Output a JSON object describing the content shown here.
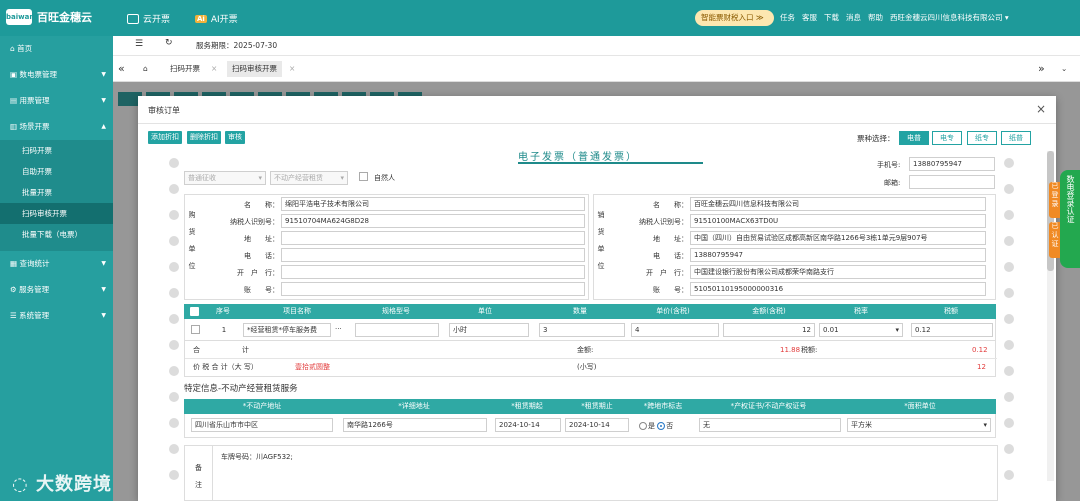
{
  "app": {
    "brand_badge": "baiwang",
    "name": "百旺金穗云"
  },
  "topnav": [
    {
      "label": "云开票"
    },
    {
      "label": "AI开票",
      "badge": "Ai"
    }
  ],
  "entry_button": "智能票财税入口 ≫",
  "toplinks": [
    "任务",
    "客服",
    "下载",
    "消息",
    "帮助",
    "西旺金穗云四川信息科技有限公司 ▾"
  ],
  "sidebar": {
    "items": [
      {
        "label": "首页"
      },
      {
        "label": "数电票管理"
      },
      {
        "label": "用票管理"
      },
      {
        "label": "场景开票"
      }
    ],
    "sub_items": [
      {
        "label": "扫码开票"
      },
      {
        "label": "自助开票"
      },
      {
        "label": "批量开票"
      },
      {
        "label": "扫码审核开票"
      },
      {
        "label": "批量下载（电票）"
      }
    ],
    "items_after": [
      {
        "label": "查询统计"
      },
      {
        "label": "服务管理"
      },
      {
        "label": "系统管理"
      }
    ]
  },
  "toolbar": {
    "service_period": "服务期限：2025-07-30"
  },
  "tabs": [
    "扫码开票",
    "扫码审核开票"
  ],
  "modal": {
    "title": "审核订单",
    "actions": [
      "添加折扣",
      "删除折扣",
      "审核"
    ],
    "ptype_label": "票种选择：",
    "ptypes": [
      "电普",
      "电专",
      "纸专",
      "纸普"
    ],
    "invoice_title": "电子发票（普通发票）",
    "phone_label": "手机号:",
    "phone_value": "13880795947",
    "email_label": "邮箱:",
    "email_value": "",
    "select1": "普通征收",
    "select2": "不动产经营租赁",
    "natural_person": "自然人",
    "buyer": {
      "side": [
        "购",
        "货",
        "单",
        "位"
      ],
      "rows": [
        {
          "label": "名　　称：",
          "value": "绵阳平浩电子技术有限公司"
        },
        {
          "label": "纳税人识别号：",
          "value": "91510704MA624G8D28"
        },
        {
          "label": "地　　址：",
          "value": ""
        },
        {
          "label": "电　　话：",
          "value": ""
        },
        {
          "label": "开　户　行：",
          "value": ""
        },
        {
          "label": "账　　号：",
          "value": ""
        }
      ]
    },
    "seller": {
      "side": [
        "销",
        "货",
        "单",
        "位"
      ],
      "rows": [
        {
          "label": "名　　称：",
          "value": "百旺金穗云四川信息科技有限公司"
        },
        {
          "label": "纳税人识别号：",
          "value": "91510100MACX63TD0U"
        },
        {
          "label": "地　　址：",
          "value": "中国（四川）自由贸易试验区成都高新区南华路1266号3栋1单元9层907号"
        },
        {
          "label": "电　　话：",
          "value": "13880795947"
        },
        {
          "label": "开　户　行：",
          "value": "中国建设银行股份有限公司成都荣华南路支行"
        },
        {
          "label": "账　　号：",
          "value": "51050110195000000316"
        }
      ]
    },
    "goods_headers": [
      "序号",
      "项目名称",
      "规格型号",
      "单位",
      "数量",
      "单价(含税)",
      "金额(含税)",
      "税率",
      "税额"
    ],
    "goods_row": {
      "no": "1",
      "name": "*经营租赁*停车服务费",
      "spec": "",
      "unit": "小时",
      "qty": "3",
      "price": "4",
      "amount": "12",
      "rate": "0.01",
      "tax": "0.12"
    },
    "total_label": "合　　　　　　计",
    "amount_label": "金额:",
    "amount_value": "11.88",
    "tax_label": "税额:",
    "tax_value": "0.12",
    "grand_label": "价 税 合 计（大 写）",
    "grand_upper": "壹拾贰圆整",
    "small_label": "(小写)",
    "grand_lower": "12",
    "special_title": "特定信息-不动产经营租赁服务",
    "estate_headers": [
      "*不动产地址",
      "*详细地址",
      "*租赁期起",
      "*租赁期止",
      "*跨地市标志",
      "*产权证书/不动产权证号",
      "*面积单位"
    ],
    "estate_row": {
      "addr": "四川省乐山市市中区",
      "detail": "南华路1266号",
      "start": "2024-10-14",
      "end": "2024-10-14",
      "yes": "是",
      "no": "否",
      "cert": "无",
      "unit": "平方米"
    },
    "remark_label": [
      "备",
      "注"
    ],
    "remark_value": "车牌号码：川AGF532;"
  },
  "right_float": "数电登录认证",
  "orange_tabs": [
    "已登录",
    "已认证"
  ],
  "watermark": "大数跨境",
  "colors": {
    "accent": "#23a3a3",
    "sidebar": "#269f9f",
    "topbar": "#1e9a9a",
    "red": "#e23c3c"
  }
}
